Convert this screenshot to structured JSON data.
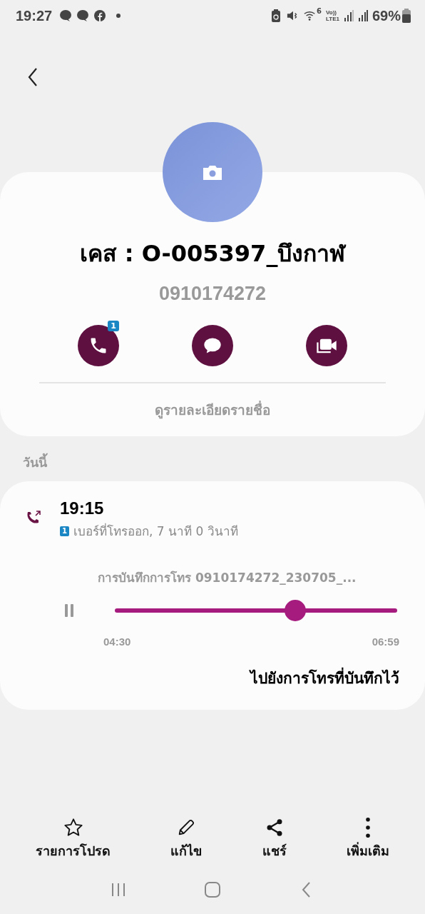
{
  "status_bar": {
    "time": "19:27",
    "network": "Vo))\nLTE1",
    "sim_badge": "6",
    "battery": "69%"
  },
  "contact": {
    "name": "เคส : O-005397_บึงกาฬ",
    "number": "0910174272",
    "call_badge": "1",
    "details_link": "ดูรายละเอียดรายชื่อ"
  },
  "section_label": "วันนี้",
  "call_log": {
    "time": "19:15",
    "sim": "1",
    "description": "เบอร์ที่โทรออก, 7 นาที 0 วินาที",
    "recording": {
      "title": "การบันทึกการโทร 0910174272_230705_...",
      "level": 0.64,
      "elapsed": "04:30",
      "total": "06:59"
    },
    "go_link": "ไปยังการโทรที่บันทึกไว้"
  },
  "actions": [
    {
      "kind": "star",
      "label": "รายการโปรด"
    },
    {
      "kind": "edit",
      "label": "แก้ไข"
    },
    {
      "kind": "share",
      "label": "แชร์"
    },
    {
      "kind": "more",
      "label": "เพิ่มเติม"
    }
  ]
}
